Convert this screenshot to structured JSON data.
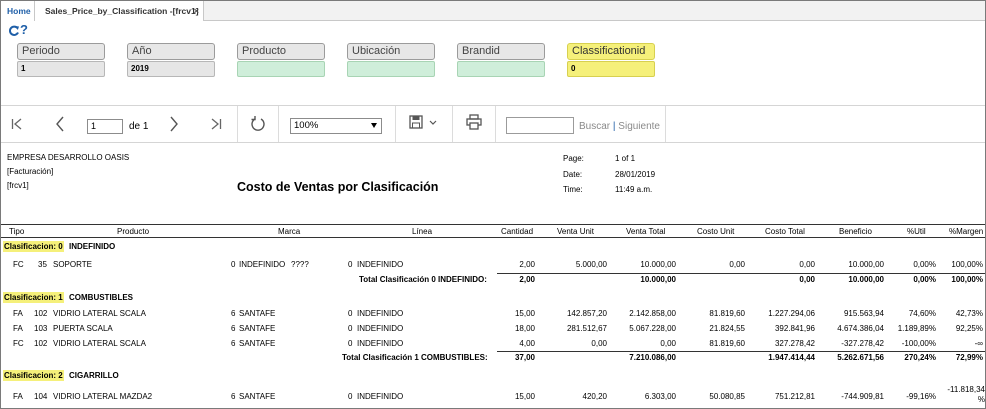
{
  "tabs": {
    "home": "Home",
    "active": "Sales_Price_by_Classification -[frcv1]",
    "close": "×"
  },
  "help_glyph": "?",
  "params": [
    {
      "label": "Periodo",
      "value": "1"
    },
    {
      "label": "Año",
      "value": "2019"
    },
    {
      "label": "Producto",
      "value": ""
    },
    {
      "label": "Ubicación",
      "value": ""
    },
    {
      "label": "Brandid",
      "value": ""
    },
    {
      "label": "Classificationid",
      "value": "0"
    }
  ],
  "toolbar": {
    "page": "1",
    "of": "de 1",
    "zoom": "100%",
    "search_label": "Buscar",
    "separator": "|",
    "next_label": "Siguiente"
  },
  "report": {
    "company": "EMPRESA DESARROLLO OASIS",
    "sub1": "[Facturación]",
    "sub2": "[frcv1]",
    "title": "Costo de Ventas por Clasificación",
    "meta": [
      {
        "k": "Page:",
        "v": "1 of 1"
      },
      {
        "k": "Date:",
        "v": "28/01/2019"
      },
      {
        "k": "Time:",
        "v": "11:49 a.m."
      }
    ],
    "headers": [
      "Tipo",
      "Producto",
      "Marca",
      "Línea",
      "Cantidad",
      "Venta Unit",
      "Venta Total",
      "Costo Unit",
      "Costo Total",
      "Beneficio",
      "%Util",
      "%Margen"
    ],
    "groups": [
      {
        "label": "Clasificacion: 0",
        "name": "INDEFINIDO",
        "rows": [
          [
            "FC",
            "35",
            "SOPORTE",
            "0",
            "INDEFINIDO",
            "????",
            "0",
            "INDEFINIDO",
            "2,00",
            "5.000,00",
            "10.000,00",
            "0,00",
            "0,00",
            "10.000,00",
            "0,00%",
            "100,00%"
          ]
        ],
        "total": {
          "label": "Total Clasificación  0 INDEFINIDO:",
          "cantidad": "2,00",
          "venta_total": "10.000,00",
          "costo_total": "0,00",
          "beneficio": "10.000,00",
          "util": "0,00%",
          "margen": "100,00%"
        }
      },
      {
        "label": "Clasificacion: 1",
        "name": "COMBUSTIBLES",
        "rows": [
          [
            "FA",
            "102",
            "VIDRIO LATERAL SCALA",
            "6",
            "SANTAFE",
            "",
            "0",
            "INDEFINIDO",
            "15,00",
            "142.857,20",
            "2.142.858,00",
            "81.819,60",
            "1.227.294,06",
            "915.563,94",
            "74,60%",
            "42,73%"
          ],
          [
            "FA",
            "103",
            "PUERTA SCALA",
            "6",
            "SANTAFE",
            "",
            "0",
            "INDEFINIDO",
            "18,00",
            "281.512,67",
            "5.067.228,00",
            "21.824,55",
            "392.841,96",
            "4.674.386,04",
            "1.189,89%",
            "92,25%"
          ],
          [
            "FC",
            "102",
            "VIDRIO LATERAL SCALA",
            "6",
            "SANTAFE",
            "",
            "0",
            "INDEFINIDO",
            "4,00",
            "0,00",
            "0,00",
            "81.819,60",
            "327.278,42",
            "-327.278,42",
            "-100,00%",
            "-∞"
          ]
        ],
        "total": {
          "label": "Total Clasificación  1 COMBUSTIBLES:",
          "cantidad": "37,00",
          "venta_total": "7.210.086,00",
          "costo_total": "1.947.414,44",
          "beneficio": "5.262.671,56",
          "util": "270,24%",
          "margen": "72,99%"
        }
      },
      {
        "label": "Clasificacion: 2",
        "name": "CIGARRILLO",
        "rows": [
          [
            "FA",
            "104",
            "VIDRIO LATERAL MAZDA2",
            "6",
            "SANTAFE",
            "",
            "0",
            "INDEFINIDO",
            "15,00",
            "420,20",
            "6.303,00",
            "50.080,85",
            "751.212,81",
            "-744.909,81",
            "-99,16%",
            "-11.818,34\n%"
          ]
        ]
      }
    ]
  },
  "colors": {
    "highlight": "#f5f07a",
    "green_field": "#cfeeda",
    "link": "#1f5fa8"
  }
}
